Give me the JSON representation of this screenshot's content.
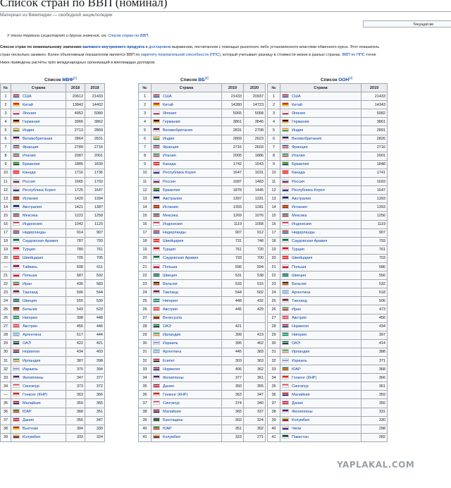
{
  "page": {
    "title": "Список стран по ВВП (номинал)",
    "tagline": "Материал из Википедии — свободной энциклопедии",
    "note_box": "Текущая ве",
    "hatnote_pre": "У этого термина существуют и другие значения, см. ",
    "hatnote_link": "Список стран по ВВП",
    "hatnote_post": ".",
    "p1_a": "Список стран по номинальному значению ",
    "p1_b": "валового внутреннего продукта",
    "p1_c": " в ",
    "p1_d": "долларовом",
    "p1_e": " выражении, посчитанном с помощью рыночного либо установленного властями обменного курса. Этот показатель",
    "p2_a": "стран несколько занижен. Более объективным показателем является ВВП по ",
    "p2_b": "паритету покупательной способности (ППС)",
    "p2_c": ", который учитывает разницу в стоимости жизни в разных странах. ",
    "p2_d": "ВВП по ППС",
    "p2_e": " точне",
    "p3": "Ниже приведены расчёты трёх международных организаций в миллиардах долларов."
  },
  "colors": {
    "link": "#0645ad",
    "header_bg": "#eaecf0",
    "cell_bg": "#f8f9fa",
    "border": "#a2a9b1"
  },
  "tables": [
    {
      "caption_pre": "Список ",
      "caption_link": "МВФ",
      "caption_ref": "[1]",
      "headers": [
        "№",
        "Страна",
        "2018",
        "2019"
      ],
      "rows": [
        [
          "1",
          "США",
          "20612",
          "21433"
        ],
        [
          "2",
          "Китай",
          "13842",
          "14402"
        ],
        [
          "3",
          "Япония",
          "4952",
          "5080"
        ],
        [
          "4",
          "Германия",
          "3966",
          "3862"
        ],
        [
          "5",
          "Индия",
          "2713",
          "2869"
        ],
        [
          "6",
          "Великобритания",
          "2864",
          "2831"
        ],
        [
          "7",
          "Франция",
          "2789",
          "2716"
        ],
        [
          "8",
          "Италия",
          "2087",
          "2001"
        ],
        [
          "9",
          "Бразилия",
          "1885",
          "1839"
        ],
        [
          "10",
          "Канада",
          "1716",
          "1736"
        ],
        [
          "11",
          "Россия",
          "1665",
          "1702"
        ],
        [
          "12",
          "Республика Корея",
          "1725",
          "1647"
        ],
        [
          "13",
          "Испания",
          "1420",
          "1394"
        ],
        [
          "14",
          "Австралия",
          "1421",
          "1387"
        ],
        [
          "15",
          "Мексика",
          "1222",
          "1258"
        ],
        [
          "16",
          "Индонезия",
          "1042",
          "1120"
        ],
        [
          "17",
          "Нидерланды",
          "914",
          "907"
        ],
        [
          "18",
          "Саудовская Аравия",
          "787",
          "793"
        ],
        [
          "19",
          "Турция",
          "780",
          "761"
        ],
        [
          "20",
          "Швейцария",
          "705",
          "705"
        ],
        [
          "—",
          "Тайвань",
          "608",
          "611"
        ],
        [
          "21",
          "Польша",
          "587",
          "592"
        ],
        [
          "22",
          "Иран",
          "435",
          "583"
        ],
        [
          "23",
          "Таиланд",
          "506",
          "544"
        ],
        [
          "24",
          "Швеция",
          "555",
          "530"
        ],
        [
          "25",
          "Бельгия",
          "543",
          "529"
        ],
        [
          "26",
          "Нигерия",
          "398",
          "448"
        ],
        [
          "27",
          "Австрия",
          "455",
          "446"
        ],
        [
          "28",
          "Аргентина",
          "517",
          "444"
        ],
        [
          "29",
          "ОАЭ",
          "422",
          "421"
        ],
        [
          "30",
          "Норвегия",
          "434",
          "403"
        ],
        [
          "31",
          "Ирландия",
          "387",
          "398"
        ],
        [
          "32",
          "Израиль",
          "370",
          "394"
        ],
        [
          "33",
          "Филиппины",
          "347",
          "377"
        ],
        [
          "34",
          "Сингапур",
          "373",
          "372"
        ],
        [
          "—",
          "Гонконг (КНР)",
          "363",
          "366"
        ],
        [
          "35",
          "Малайзия",
          "359",
          "365"
        ],
        [
          "36",
          "ЮАР",
          "368",
          "351"
        ],
        [
          "37",
          "Дания",
          "356",
          "347"
        ],
        [
          "38",
          "Вьетнам",
          "304",
          "330"
        ],
        [
          "39",
          "Колумбия",
          "333",
          "324"
        ]
      ]
    },
    {
      "caption_pre": "Список ",
      "caption_link": "ВБ",
      "caption_ref": "[3]",
      "headers": [
        "№",
        "Страна",
        "2019",
        "2020"
      ],
      "rows": [
        [
          "1",
          "США",
          "21433",
          "20937"
        ],
        [
          "2",
          "Китай",
          "14280",
          "14723"
        ],
        [
          "3",
          "Япония",
          "5065",
          "5058"
        ],
        [
          "4",
          "Германия",
          "3861",
          "3846"
        ],
        [
          "5",
          "Великобритания",
          "2831",
          "2708"
        ],
        [
          "6",
          "Индия",
          "2869",
          "2623"
        ],
        [
          "7",
          "Франция",
          "2716",
          "2603"
        ],
        [
          "8",
          "Италия",
          "2005",
          "1886"
        ],
        [
          "9",
          "Канада",
          "1742",
          "1643"
        ],
        [
          "10",
          "Республика Корея",
          "1647",
          "1631"
        ],
        [
          "11",
          "Россия",
          "1687",
          "1483"
        ],
        [
          "12",
          "Бразилия",
          "1878",
          "1445"
        ],
        [
          "13",
          "Австралия",
          "1397",
          "1331"
        ],
        [
          "14",
          "Испания",
          "1393",
          "1281"
        ],
        [
          "15",
          "Мексика",
          "1269",
          "1076"
        ],
        [
          "16",
          "Индонезия",
          "1119",
          "1058"
        ],
        [
          "17",
          "Нидерланды",
          "907",
          "912"
        ],
        [
          "18",
          "Швейцария",
          "731",
          "748"
        ],
        [
          "19",
          "Турция",
          "761",
          "720"
        ],
        [
          "20",
          "Саудовская Аравия",
          "793",
          "700"
        ],
        [
          "21",
          "Польша",
          "596",
          "594"
        ],
        [
          "22",
          "Швеция",
          "531",
          "538"
        ],
        [
          "23",
          "Бельгия",
          "533",
          "515"
        ],
        [
          "24",
          "Таиланд",
          "544",
          "502"
        ],
        [
          "25",
          "Нигерия",
          "448",
          "432"
        ],
        [
          "26",
          "Австрия",
          "445",
          "429"
        ],
        [
          "27",
          "Венесуэла",
          "",
          ""
        ],
        [
          "28",
          "ОАЭ",
          "421",
          ""
        ],
        [
          "29",
          "Ирландия",
          "399",
          "419"
        ],
        [
          "30",
          "Израиль",
          "395",
          "402"
        ],
        [
          "31",
          "Аргентина",
          "445",
          "383"
        ],
        [
          "32",
          "Египет",
          "303",
          "363"
        ],
        [
          "33",
          "Норвегия",
          "406",
          "362"
        ],
        [
          "34",
          "Филиппины",
          "377",
          "361"
        ],
        [
          "35",
          "Дания",
          "350",
          "355"
        ],
        [
          "36",
          "Гонконг (КНР)",
          "363",
          "347"
        ],
        [
          "37",
          "Сингапур",
          "374",
          "340"
        ],
        [
          "38",
          "Малайзия",
          "365",
          "337"
        ],
        [
          "39",
          "Бангладеш",
          "303",
          "324"
        ],
        [
          "40",
          "ЮАР",
          "351",
          "302"
        ],
        [
          "41",
          "Колумбия",
          "323",
          "271"
        ]
      ]
    },
    {
      "caption_pre": "Список ",
      "caption_link": "ООН",
      "caption_ref": "[4]",
      "headers": [
        "№",
        "Страна",
        "2019"
      ],
      "rows": [
        [
          "1",
          "США",
          "21433"
        ],
        [
          "2",
          "Китай",
          "14343"
        ],
        [
          "3",
          "Япония",
          "5082"
        ],
        [
          "4",
          "Германия",
          "3861"
        ],
        [
          "5",
          "Индия",
          "2891"
        ],
        [
          "6",
          "Великобритания",
          "2826"
        ],
        [
          "7",
          "Франция",
          "2716"
        ],
        [
          "8",
          "Италия",
          "2001"
        ],
        [
          "9",
          "Бразилия",
          "1848"
        ],
        [
          "10",
          "Канада",
          "1741"
        ],
        [
          "11",
          "Россия",
          "1693"
        ],
        [
          "12",
          "Республика Корея",
          "1647"
        ],
        [
          "13",
          "Австралия",
          "1393"
        ],
        [
          "14",
          "Испания",
          "1393"
        ],
        [
          "15",
          "Мексика",
          "1256"
        ],
        [
          "16",
          "Индонезия",
          "1119"
        ],
        [
          "17",
          "Нидерланды",
          "907"
        ],
        [
          "18",
          "Саудовская Аравия",
          "793"
        ],
        [
          "19",
          "Турция",
          "761"
        ],
        [
          "20",
          "Швейцария",
          "703"
        ],
        [
          "21",
          "Польша",
          "586"
        ],
        [
          "22",
          "Швеция",
          "556"
        ],
        [
          "23",
          "Бельгия",
          "532"
        ],
        [
          "24",
          "Аргентина",
          "518"
        ],
        [
          "25",
          "Таиланд",
          "506"
        ],
        [
          "26",
          "Иран",
          "473"
        ],
        [
          "27",
          "Австрия",
          "456"
        ],
        [
          "28",
          "Норвегия",
          "434"
        ],
        [
          "29",
          "Нигерия",
          "397"
        ],
        [
          "30",
          "ОАЭ",
          "414"
        ],
        [
          "31",
          "Ирландия",
          "388"
        ],
        [
          "32",
          "Израиль",
          "371"
        ],
        [
          "33",
          "ЮАР",
          "368"
        ],
        [
          "34",
          "Гонконг (КНР)",
          "366"
        ],
        [
          "35",
          "Сингапур",
          "361"
        ],
        [
          "36",
          "Малайзия",
          "359"
        ],
        [
          "37",
          "Дания",
          "355"
        ],
        [
          "38",
          "Филиппины",
          "331"
        ],
        [
          "39",
          "Колумбия",
          "330"
        ],
        [
          "40",
          "Чили",
          "298"
        ],
        [
          "41",
          "Пакистан",
          "282"
        ]
      ]
    }
  ],
  "flags": {
    "США": [
      "#b22234",
      "#ffffff",
      "#3c3b6e"
    ],
    "Китай": [
      "#de2910",
      "#de2910",
      "#ffde00"
    ],
    "Япония": [
      "#ffffff",
      "#ffffff",
      "#bc002d"
    ],
    "Германия": [
      "#000000",
      "#dd0000",
      "#ffce00"
    ],
    "Индия": [
      "#ff9933",
      "#ffffff",
      "#138808"
    ],
    "Великобритания": [
      "#012169",
      "#c8102e",
      "#ffffff"
    ],
    "Франция": [
      "#0055a4",
      "#ffffff",
      "#ef4135"
    ],
    "Италия": [
      "#009246",
      "#ffffff",
      "#ce2b37"
    ],
    "Бразилия": [
      "#009c3b",
      "#ffdf00",
      "#002776"
    ],
    "Канада": [
      "#ff0000",
      "#ffffff",
      "#ff0000"
    ],
    "Россия": [
      "#ffffff",
      "#0039a6",
      "#d52b1e"
    ],
    "Республика Корея": [
      "#ffffff",
      "#cd2e3a",
      "#0047a0"
    ],
    "Испания": [
      "#aa151b",
      "#f1bf00",
      "#aa151b"
    ],
    "Австралия": [
      "#012169",
      "#012169",
      "#ffffff"
    ],
    "Мексика": [
      "#006847",
      "#ffffff",
      "#ce1126"
    ],
    "Индонезия": [
      "#ce1126",
      "#ffffff",
      "#ffffff"
    ],
    "Нидерланды": [
      "#ae1c28",
      "#ffffff",
      "#21468b"
    ],
    "Саудовская Аравия": [
      "#006c35",
      "#006c35",
      "#ffffff"
    ],
    "Турция": [
      "#e30a17",
      "#e30a17",
      "#ffffff"
    ],
    "Швейцария": [
      "#ff0000",
      "#ffffff",
      "#ff0000"
    ],
    "Тайвань": [
      "#fe0000",
      "#000095",
      "#ffffff"
    ],
    "Польша": [
      "#ffffff",
      "#dc143c",
      "#dc143c"
    ],
    "Иран": [
      "#239f40",
      "#ffffff",
      "#da0000"
    ],
    "Таиланд": [
      "#a51931",
      "#2d2a4a",
      "#f4f5f8"
    ],
    "Швеция": [
      "#006aa7",
      "#fecc00",
      "#006aa7"
    ],
    "Бельгия": [
      "#000000",
      "#fae042",
      "#ed2939"
    ],
    "Нигерия": [
      "#008751",
      "#ffffff",
      "#008751"
    ],
    "Австрия": [
      "#ed2939",
      "#ffffff",
      "#ed2939"
    ],
    "Аргентина": [
      "#74acdf",
      "#ffffff",
      "#74acdf"
    ],
    "ОАЭ": [
      "#00732f",
      "#ffffff",
      "#000000"
    ],
    "Норвегия": [
      "#ba0c2f",
      "#ffffff",
      "#00205b"
    ],
    "Ирландия": [
      "#169b62",
      "#ffffff",
      "#ff883e"
    ],
    "Израиль": [
      "#ffffff",
      "#0038b8",
      "#ffffff"
    ],
    "Филиппины": [
      "#0038a8",
      "#ce1126",
      "#ffffff"
    ],
    "Сингапур": [
      "#ef3340",
      "#ffffff",
      "#ffffff"
    ],
    "Гонконг (КНР)": [
      "#de2910",
      "#de2910",
      "#ffffff"
    ],
    "Малайзия": [
      "#cc0001",
      "#ffffff",
      "#010066"
    ],
    "ЮАР": [
      "#007a4d",
      "#ffb612",
      "#de3831"
    ],
    "Дания": [
      "#c60c30",
      "#ffffff",
      "#c60c30"
    ],
    "Вьетнам": [
      "#da251d",
      "#da251d",
      "#ffff00"
    ],
    "Колумбия": [
      "#fcd116",
      "#003893",
      "#ce1126"
    ],
    "Венесуэла": [
      "#ffcc00",
      "#00247d",
      "#cf142b"
    ],
    "Египет": [
      "#ce1126",
      "#ffffff",
      "#000000"
    ],
    "Бангладеш": [
      "#006a4e",
      "#f42a41",
      "#006a4e"
    ],
    "Чили": [
      "#ffffff",
      "#d52b1e",
      "#0039a6"
    ],
    "Пакистан": [
      "#01411c",
      "#01411c",
      "#ffffff"
    ]
  },
  "watermark": "YAPLAKAL.COM"
}
